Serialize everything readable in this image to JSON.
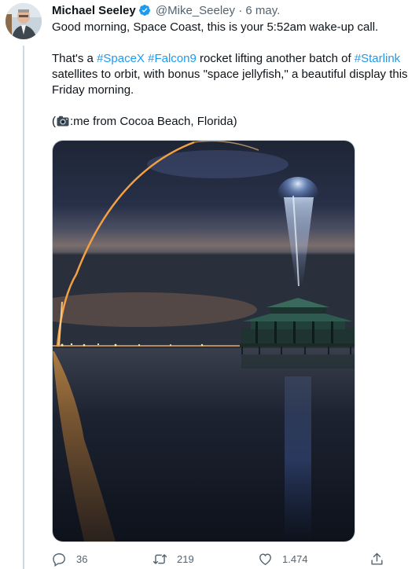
{
  "tweet": {
    "author_name": "Michael Seeley",
    "handle": "@Mike_Seeley",
    "separator": "·",
    "date": "6 may.",
    "line1": "Good morning, Space Coast, this is your 5:52am wake-up call.",
    "p2_start": "That's a ",
    "tag_spacex": "#SpaceX",
    "p2_space": " ",
    "tag_falcon9": "#Falcon9",
    "p2_mid": " rocket lifting another batch of ",
    "tag_starlink": "#Starlink",
    "p2_end": " satellites to orbit, with bonus \"space jellyfish,\" a beautiful display this Friday morning.",
    "p3_open": "(",
    "p3_rest": ":me from Cocoa Beach, Florida)"
  },
  "actions": {
    "replies": "36",
    "retweets": "219",
    "likes": "1.474"
  },
  "colors": {
    "link": "#1d9bf0",
    "secondary": "#536471",
    "verified": "#1d9bf0"
  },
  "icons": [
    "verified-badge-icon",
    "camera-icon",
    "reply-icon",
    "retweet-icon",
    "like-icon",
    "share-icon"
  ]
}
